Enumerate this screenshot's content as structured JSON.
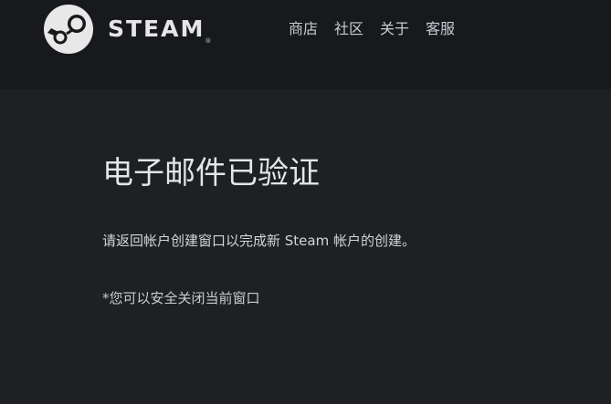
{
  "header": {
    "logo_text": "STEAM",
    "logo_reg_mark": "®",
    "nav": [
      {
        "label": "商店"
      },
      {
        "label": "社区"
      },
      {
        "label": "关于"
      },
      {
        "label": "客服"
      }
    ]
  },
  "main": {
    "title": "电子邮件已验证",
    "message": "请返回帐户创建窗口以完成新 Steam 帐户的创建。",
    "note": "*您可以安全关闭当前窗口"
  },
  "colors": {
    "header_bg": "#17191d",
    "page_bg": "#1e2024",
    "text_primary": "#e4e5e7",
    "text_secondary": "#d3d5d9"
  },
  "icons": {
    "logo": "steam-logo-icon"
  }
}
